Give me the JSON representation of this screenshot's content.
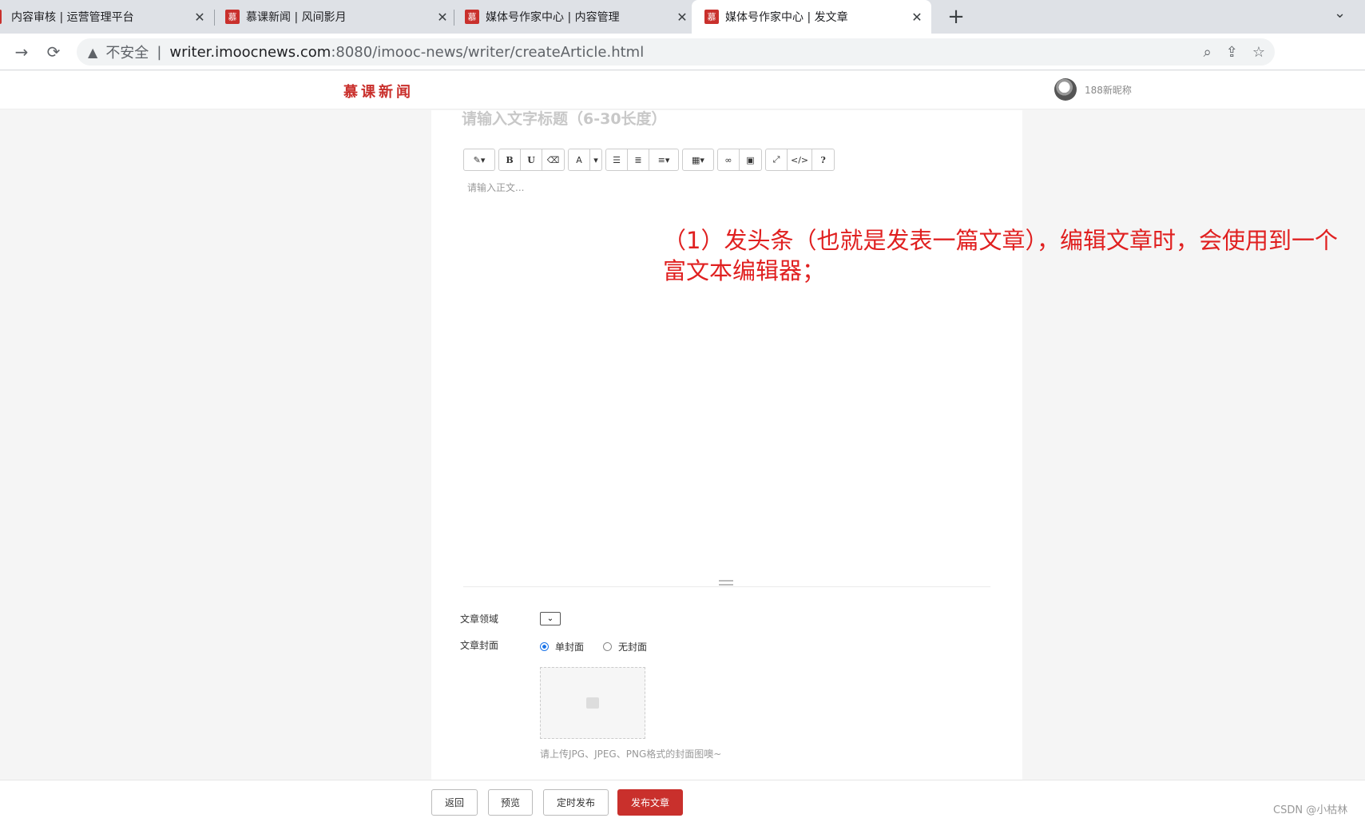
{
  "browser": {
    "tabs": [
      {
        "favicon": "",
        "title": "内容审核 | 运营管理平台"
      },
      {
        "favicon": "慕",
        "title": "慕课新闻 | 风间影月"
      },
      {
        "favicon": "慕",
        "title": "媒体号作家中心 | 内容管理"
      },
      {
        "favicon": "慕",
        "title": "媒体号作家中心 | 发文章"
      }
    ],
    "active_tab": 3,
    "security_label": "不安全",
    "url_host": "writer.imoocnews.com",
    "url_rest": ":8080/imooc-news/writer/createArticle.html"
  },
  "site": {
    "logo": "慕课新闻",
    "username": "188新昵称"
  },
  "editor": {
    "title_placeholder": "请输入文字标题（6-30长度）",
    "body_placeholder": "请输入正文...",
    "toolbar": {
      "bold": "B",
      "underline": "U",
      "highlight": "A",
      "help": "?",
      "code": "</>"
    }
  },
  "form": {
    "domain_label": "文章领域",
    "cover_label": "文章封面",
    "cover_options": [
      "单封面",
      "无封面"
    ],
    "cover_selected": 0,
    "upload_hint": "请上传JPG、JPEG、PNG格式的封面图噢~"
  },
  "footer": {
    "back": "返回",
    "preview": "预览",
    "schedule": "定时发布",
    "publish": "发布文章",
    "watermark": "CSDN @小枯林"
  },
  "annotation": "（1）发头条（也就是发表一篇文章），编辑文章时，会使用到一个富文本编辑器；",
  "colors": {
    "brand": "#c9302c",
    "annotation": "#e02020"
  }
}
